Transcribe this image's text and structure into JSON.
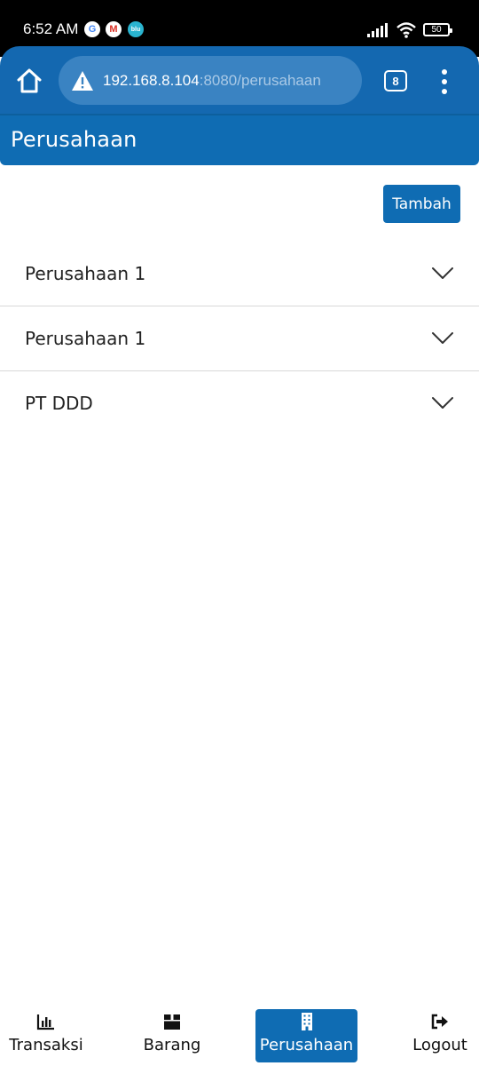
{
  "status_bar": {
    "time": "6:52 AM",
    "notifications": [
      "G",
      "M",
      "blu"
    ],
    "battery": "50"
  },
  "browser": {
    "url_host": "192.168.8.104",
    "url_path": ":8080/perusahaan",
    "tab_count": "8",
    "icons": [
      "home-icon",
      "warning-icon",
      "tabs-icon",
      "more-vert-icon"
    ]
  },
  "header": {
    "title": "Perusahaan"
  },
  "actions": {
    "add_label": "Tambah"
  },
  "companies": [
    {
      "name": "Perusahaan 1"
    },
    {
      "name": "Perusahaan 1"
    },
    {
      "name": "PT DDD"
    }
  ],
  "bottom_nav": {
    "items": [
      {
        "label": "Transaksi",
        "icon": "chart-icon",
        "active": false
      },
      {
        "label": "Barang",
        "icon": "box-icon",
        "active": false
      },
      {
        "label": "Perusahaan",
        "icon": "building-icon",
        "active": true
      },
      {
        "label": "Logout",
        "icon": "logout-icon",
        "active": false
      }
    ]
  },
  "colors": {
    "primary": "#0f6cb3",
    "browser_bar": "#1468b0",
    "url_box": "#3a83c2",
    "divider": "#d8d8d8"
  }
}
